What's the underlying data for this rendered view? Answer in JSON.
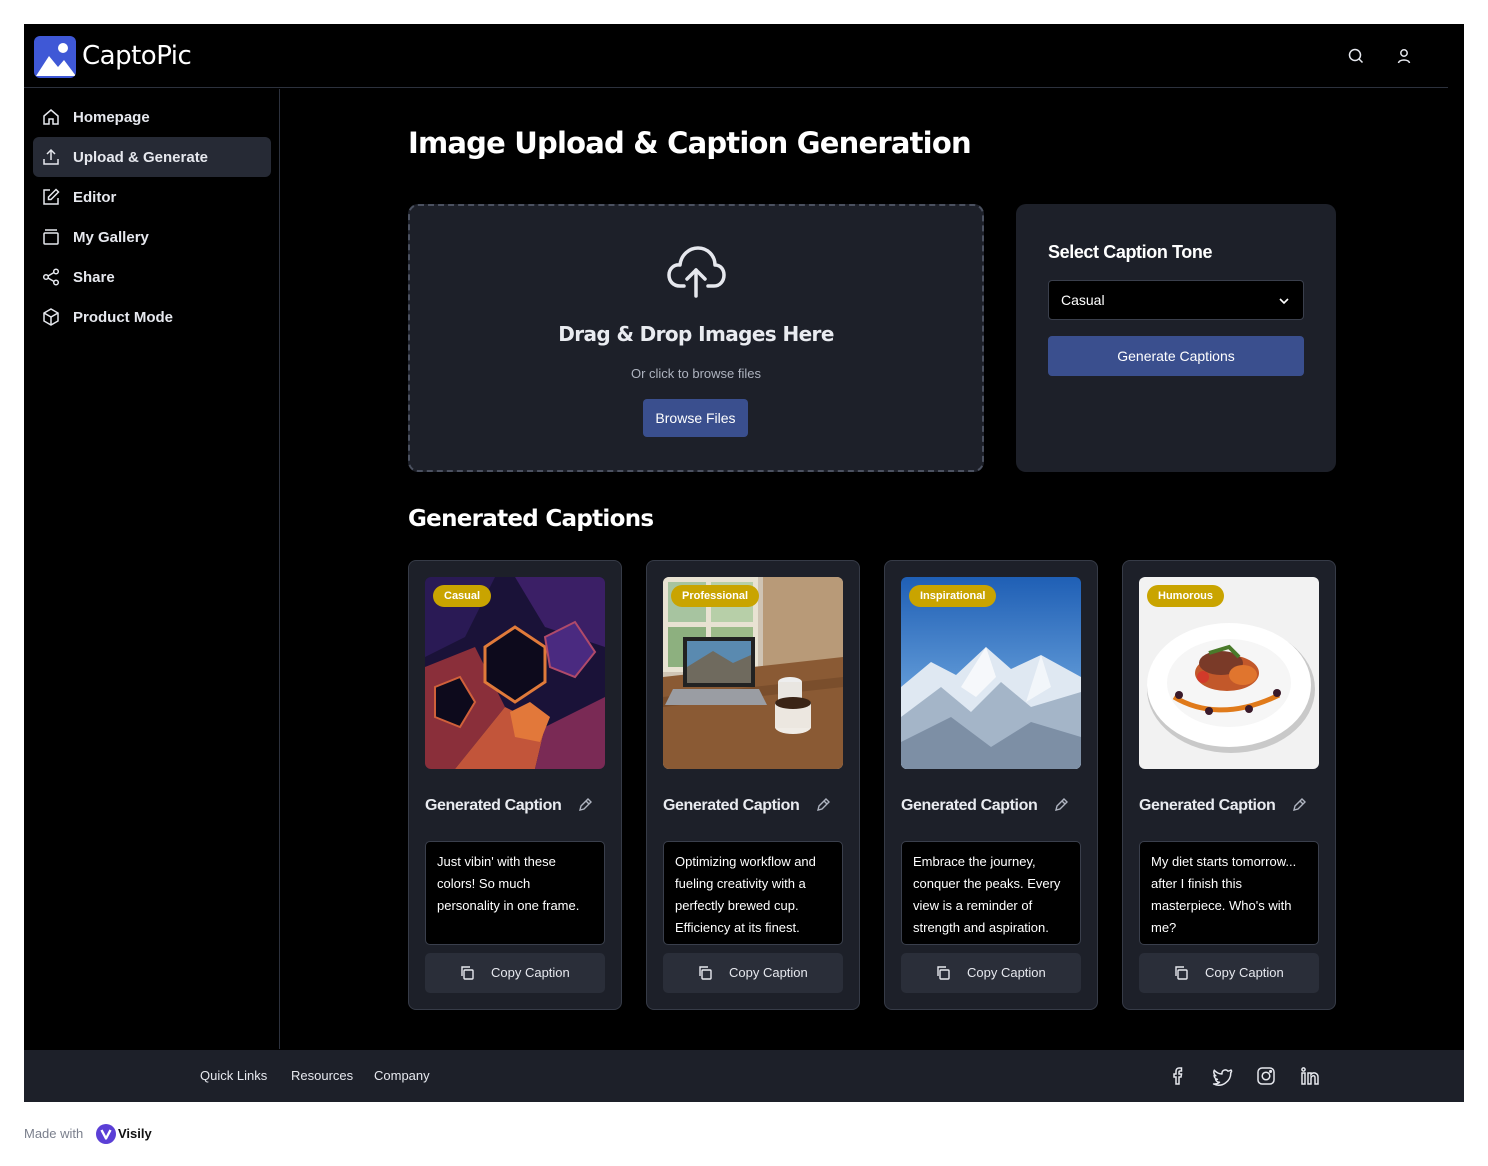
{
  "app": {
    "name": "CaptoPic"
  },
  "colors": {
    "accent": "#3a4f8e",
    "badge": "#c9a400",
    "panel": "#1d2029",
    "logo": "#3f58d6"
  },
  "header": {
    "icons": [
      "search-icon",
      "user-icon"
    ]
  },
  "sidebar": {
    "items": [
      {
        "label": "Homepage",
        "icon": "home-icon",
        "active": false
      },
      {
        "label": "Upload & Generate",
        "icon": "upload-icon",
        "active": true
      },
      {
        "label": "Editor",
        "icon": "edit-icon",
        "active": false
      },
      {
        "label": "My Gallery",
        "icon": "gallery-icon",
        "active": false
      },
      {
        "label": "Share",
        "icon": "share-icon",
        "active": false
      },
      {
        "label": "Product Mode",
        "icon": "box-icon",
        "active": false
      }
    ]
  },
  "main": {
    "title": "Image Upload & Caption Generation",
    "upload": {
      "title": "Drag & Drop Images Here",
      "subtitle": "Or click to browse files",
      "button": "Browse Files"
    },
    "tone": {
      "title": "Select Caption Tone",
      "selected": "Casual",
      "button": "Generate Captions"
    },
    "captions_title": "Generated Captions",
    "cards": [
      {
        "badge": "Casual",
        "title": "Generated Caption",
        "text": "Just vibin' with these colors! So much personality in one frame.",
        "copy": "Copy Caption",
        "image": "abstract-hexagon-pattern"
      },
      {
        "badge": "Professional",
        "title": "Generated Caption",
        "text": "Optimizing workflow and fueling creativity with a perfectly brewed cup. Efficiency at its finest.",
        "copy": "Copy Caption",
        "image": "laptop-and-coffee-on-desk"
      },
      {
        "badge": "Inspirational",
        "title": "Generated Caption",
        "text": "Embrace the journey, conquer the peaks. Every view is a reminder of strength and aspiration.",
        "copy": "Copy Caption",
        "image": "snowy-mountain-range"
      },
      {
        "badge": "Humorous",
        "title": "Generated Caption",
        "text": "My diet starts tomorrow... after I finish this masterpiece. Who's with me?",
        "copy": "Copy Caption",
        "image": "gourmet-plated-dish"
      }
    ]
  },
  "footer": {
    "links": [
      "Quick Links",
      "Resources",
      "Company"
    ],
    "social": [
      "facebook-icon",
      "twitter-icon",
      "instagram-icon",
      "linkedin-icon"
    ]
  },
  "watermark": {
    "prefix": "Made with",
    "brand": "Visily"
  }
}
